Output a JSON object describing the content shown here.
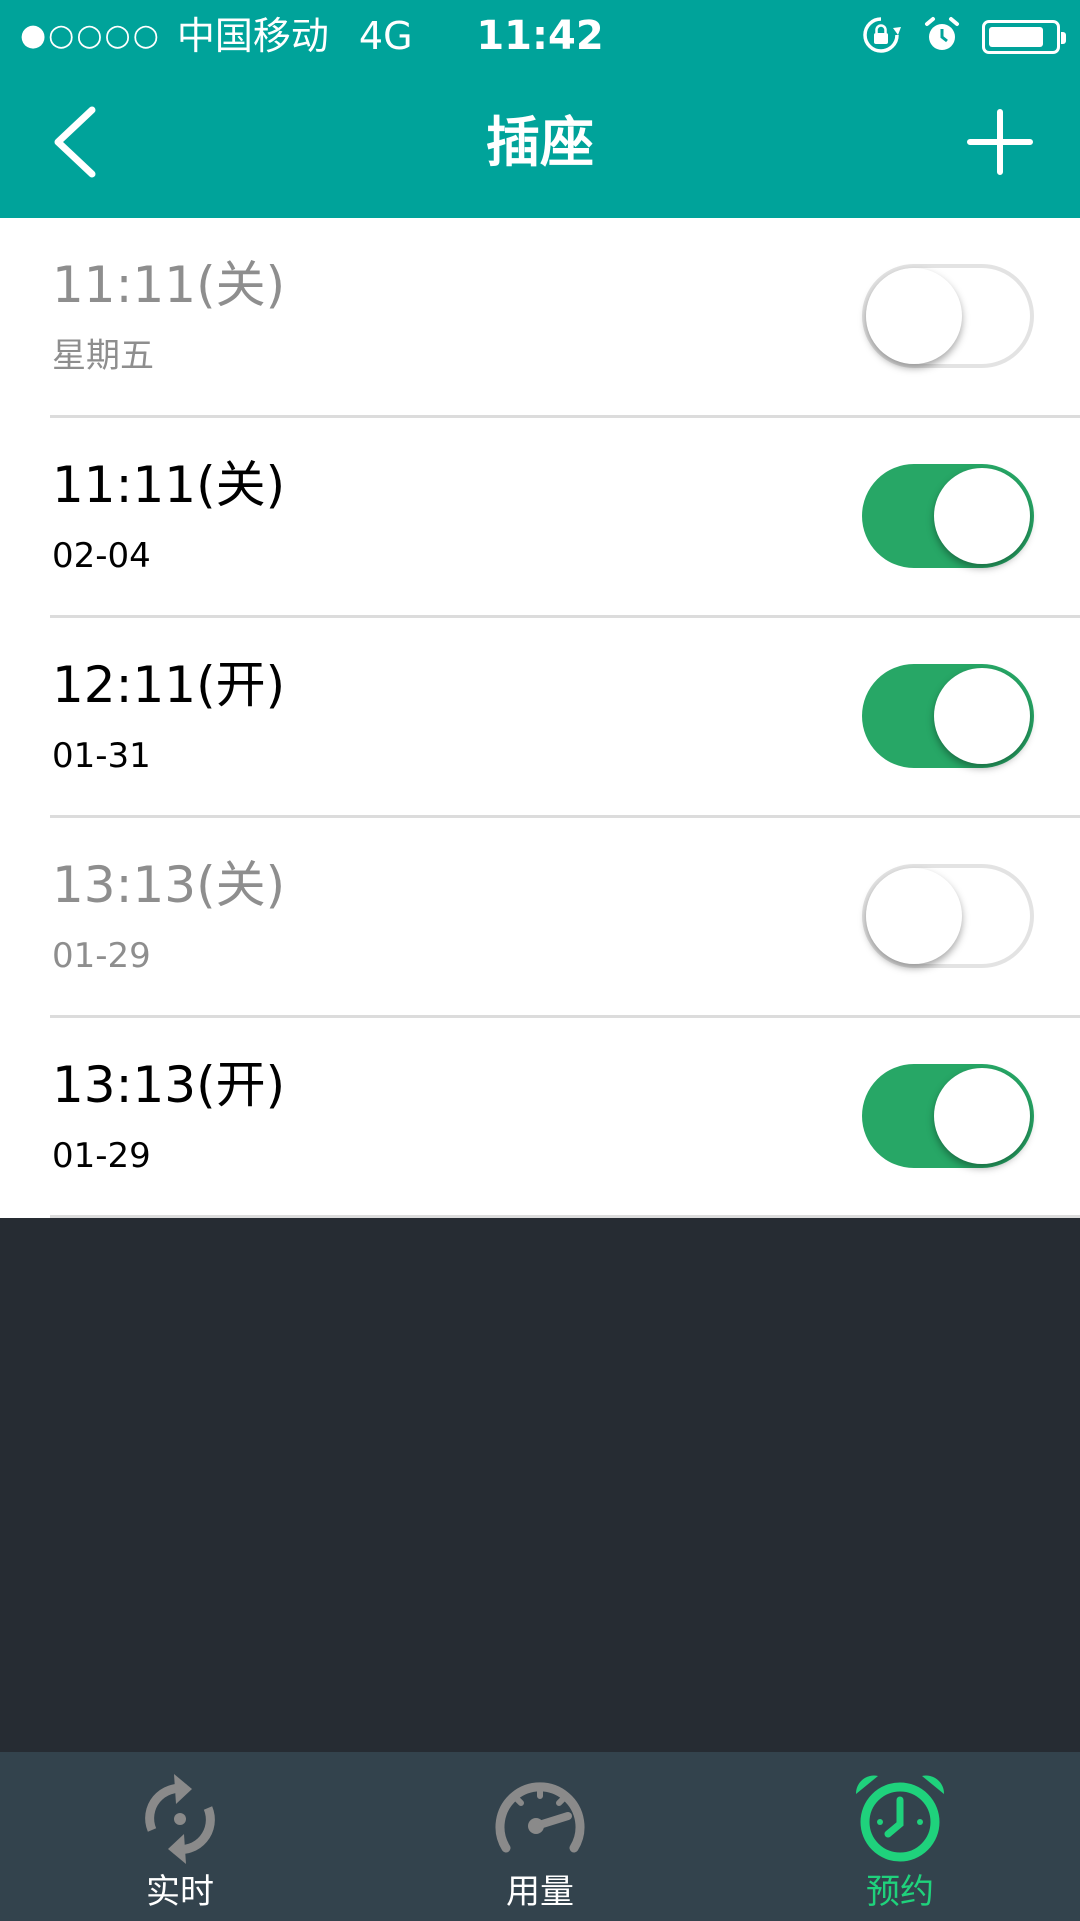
{
  "status_bar": {
    "signal": "●○○○○",
    "carrier": "中国移动",
    "network": "4G",
    "time": "11:42",
    "battery_level": 0.85
  },
  "nav": {
    "title": "插座",
    "back_icon": "chevron-left-icon",
    "add_icon": "plus-icon"
  },
  "schedules": [
    {
      "title": "11:11(关)",
      "subtitle": "星期五",
      "enabled": false
    },
    {
      "title": "11:11(关)",
      "subtitle": "02-04",
      "enabled": true
    },
    {
      "title": "12:11(开)",
      "subtitle": "01-31",
      "enabled": true
    },
    {
      "title": "13:13(关)",
      "subtitle": "01-29",
      "enabled": false
    },
    {
      "title": "13:13(开)",
      "subtitle": "01-29",
      "enabled": true
    }
  ],
  "tabs": [
    {
      "label": "实时",
      "icon": "refresh-cycle-icon",
      "active": false
    },
    {
      "label": "用量",
      "icon": "speedometer-icon",
      "active": false
    },
    {
      "label": "预约",
      "icon": "alarm-clock-icon",
      "active": true
    }
  ],
  "colors": {
    "primary": "#00a39a",
    "switch_on": "#27a766",
    "tab_bar": "#33434d",
    "tab_active": "#1fd27c",
    "background": "#262c33"
  }
}
